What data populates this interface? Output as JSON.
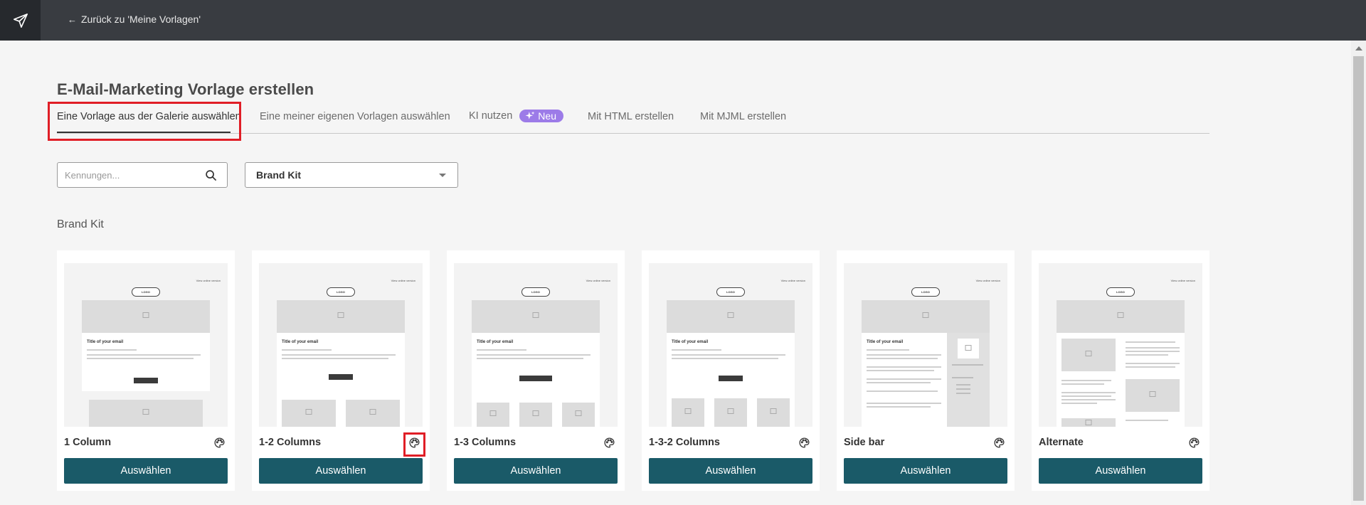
{
  "topbar": {
    "brand_icon": "paper-plane-icon",
    "back_label": "Zurück zu 'Meine Vorlagen'",
    "back_icon": "arrow-left-icon"
  },
  "page": {
    "title": "E-Mail-Marketing Vorlage erstellen"
  },
  "tabs": [
    {
      "label": "Eine Vorlage aus der Galerie auswählen",
      "active": true
    },
    {
      "label": "Eine meiner eigenen Vorlagen auswählen",
      "active": false
    },
    {
      "label": "KI nutzen",
      "active": false,
      "badge": "Neu"
    },
    {
      "label": "Mit HTML erstellen",
      "active": false
    },
    {
      "label": "Mit MJML erstellen",
      "active": false
    }
  ],
  "filters": {
    "search_placeholder": "Kennungen...",
    "search_value": "",
    "select_value": "Brand Kit"
  },
  "section": {
    "title": "Brand Kit"
  },
  "preview_text": {
    "view_online": "View online version",
    "logo": "LOGO",
    "email_title": "Title of your email"
  },
  "cards": [
    {
      "name": "1 Column",
      "button": "Auswählen"
    },
    {
      "name": "1-2 Columns",
      "button": "Auswählen"
    },
    {
      "name": "1-3 Columns",
      "button": "Auswählen"
    },
    {
      "name": "1-3-2 Columns",
      "button": "Auswählen"
    },
    {
      "name": "Side bar",
      "button": "Auswählen"
    },
    {
      "name": "Alternate",
      "button": "Auswählen"
    }
  ],
  "colors": {
    "topbar": "#393c41",
    "accent_button": "#1a5a68",
    "badge": "#9c7be8",
    "highlight": "#e01e26"
  }
}
